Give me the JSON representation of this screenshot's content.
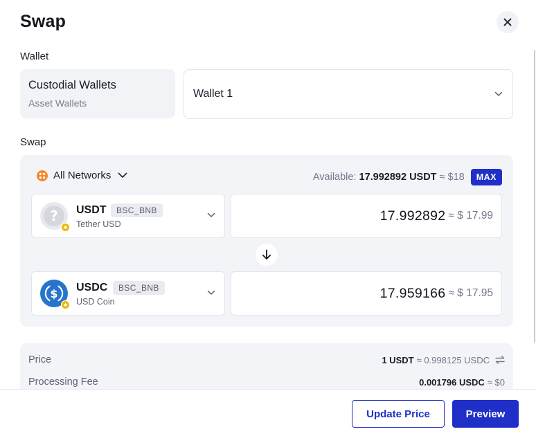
{
  "dialog": {
    "title": "Swap"
  },
  "wallet": {
    "section_label": "Wallet",
    "type_name": "Custodial Wallets",
    "type_sub": "Asset Wallets",
    "selected": "Wallet 1"
  },
  "swap": {
    "section_label": "Swap",
    "network_label": "All Networks",
    "available_label": "Available:",
    "available_amount": "17.992892 USDT",
    "available_approx": "≈",
    "available_usd": "$18",
    "max_label": "MAX",
    "from": {
      "symbol": "USDT",
      "chain": "BSC_BNB",
      "name": "Tether USD",
      "amount": "17.992892",
      "usd": "≈ $ 17.99"
    },
    "to": {
      "symbol": "USDC",
      "chain": "BSC_BNB",
      "name": "USD Coin",
      "amount": "17.959166",
      "usd": "≈ $ 17.95"
    }
  },
  "info": {
    "price_label": "Price",
    "price_left": "1 USDT",
    "price_right": "≈ 0.998125 USDC",
    "fee_label": "Processing Fee",
    "fee_left": "0.001796 USDC",
    "fee_right": "≈ $0"
  },
  "footer": {
    "update_label": "Update Price",
    "preview_label": "Preview"
  },
  "colors": {
    "accent": "#1f2fc8",
    "usdc_blue": "#2775ca",
    "bnb_yellow": "#f0b90b",
    "network_orange": "#f7882f"
  },
  "icons": {
    "close": "close-icon",
    "chevron": "chevron-down-icon",
    "networks": "all-networks-icon",
    "swap_direction": "arrow-down-icon",
    "swap_price": "swap-arrows-icon",
    "usdt_logo": "unknown-token-icon",
    "usdc_logo": "usdc-logo-icon",
    "bnb_badge": "bnb-chain-icon"
  }
}
